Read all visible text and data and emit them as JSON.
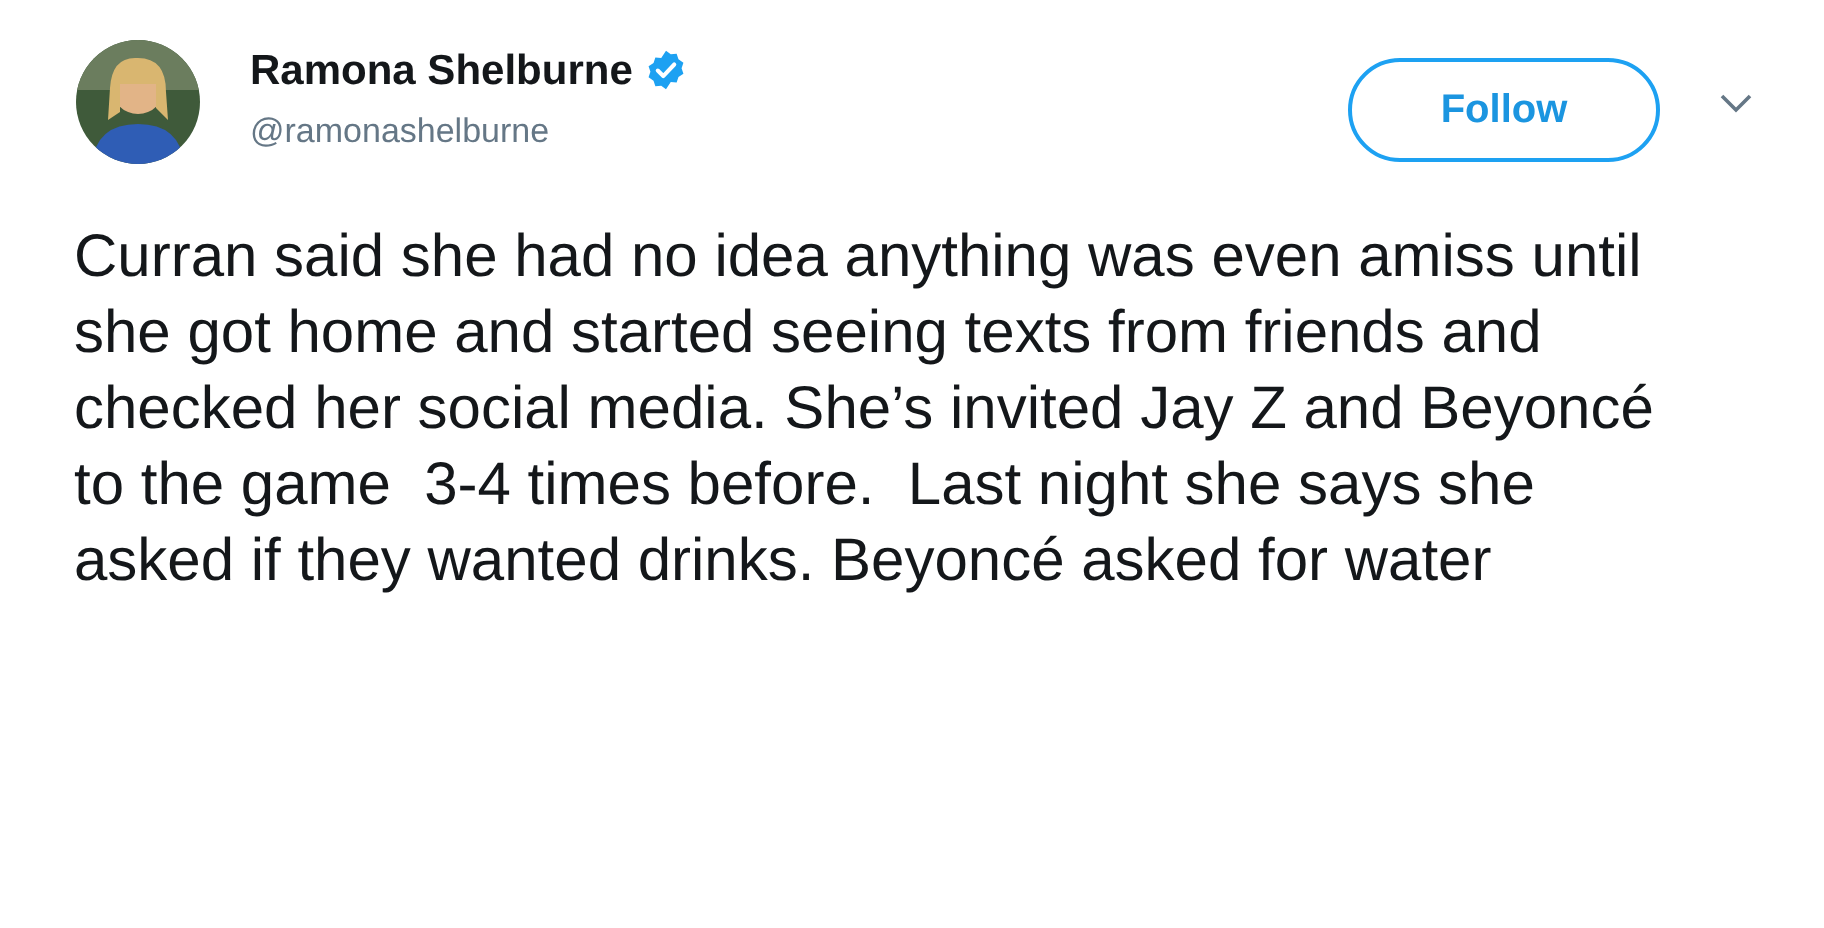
{
  "author": {
    "name": "Ramona Shelburne",
    "verified": true,
    "handle": "@ramonashelburne"
  },
  "follow_button": {
    "label": "Follow"
  },
  "tweet": {
    "text": "Curran said she had no idea anything was even amiss until she got home and started seeing texts from friends and checked her social media. She’s invited Jay Z and Beyoncé to the game  3-4 times before.  Last night she says she asked if they wanted drinks. Beyoncé asked for water"
  }
}
